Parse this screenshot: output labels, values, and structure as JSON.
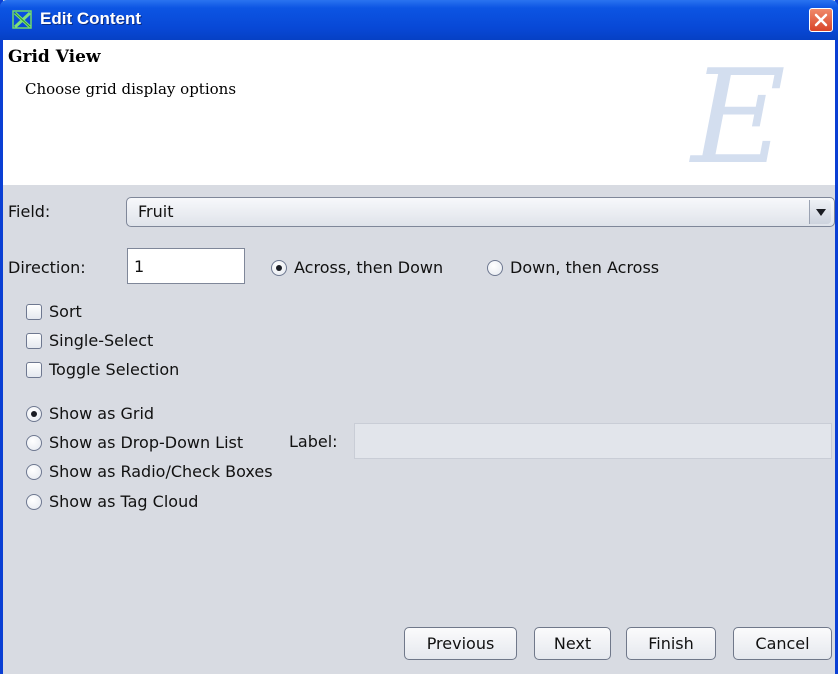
{
  "window": {
    "title": "Edit Content"
  },
  "header": {
    "title": "Grid View",
    "subtitle": "Choose grid display options",
    "watermark": "E"
  },
  "field": {
    "label": "Field:",
    "value": "Fruit"
  },
  "direction": {
    "label": "Direction:",
    "value": "1",
    "options": [
      {
        "label": "Across, then Down",
        "selected": true
      },
      {
        "label": "Down, then Across",
        "selected": false
      }
    ]
  },
  "checkboxes": [
    {
      "label": "Sort",
      "checked": false
    },
    {
      "label": "Single-Select",
      "checked": false
    },
    {
      "label": "Toggle Selection",
      "checked": false
    }
  ],
  "display_options": [
    {
      "label": "Show as Grid",
      "selected": true
    },
    {
      "label": "Show as Drop-Down List",
      "selected": false
    },
    {
      "label": "Show as Radio/Check Boxes",
      "selected": false
    },
    {
      "label": "Show as Tag Cloud",
      "selected": false
    }
  ],
  "dropdown_label": {
    "label": "Label:",
    "value": ""
  },
  "buttons": {
    "previous": "Previous",
    "next": "Next",
    "finish": "Finish",
    "cancel": "Cancel"
  },
  "colors": {
    "titlebar": "#0848d6",
    "panel": "#d8dbe2",
    "close": "#d8452a"
  },
  "icons": {
    "app": "app-icon",
    "close": "close-icon",
    "dropdown": "chevron-down-icon"
  }
}
